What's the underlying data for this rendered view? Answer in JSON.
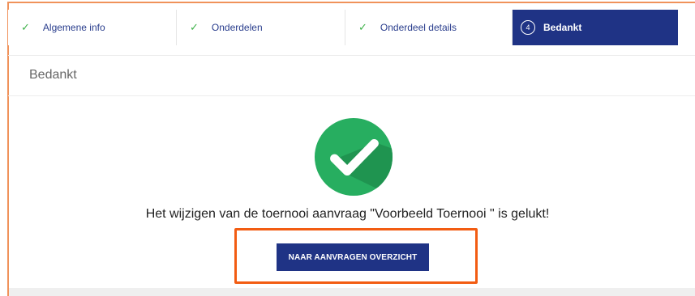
{
  "steps": [
    {
      "label": "Algemene info",
      "status": "done",
      "icon": "check-icon"
    },
    {
      "label": "Onderdelen",
      "status": "done",
      "icon": "check-icon"
    },
    {
      "label": "Onderdeel details",
      "status": "done",
      "icon": "check-icon"
    },
    {
      "number": "4",
      "label": "Bedankt",
      "status": "active"
    }
  ],
  "page": {
    "title": "Bedankt",
    "success_icon": "checkmark-circle-icon",
    "message": "Het wijzigen van de toernooi aanvraag \"Voorbeeld Toernooi \" is gelukt!",
    "button_label": "NAAR AANVRAGEN OVERZICHT"
  },
  "colors": {
    "primary": "#1f3385",
    "success": "#27ae60",
    "check": "#3fb24a",
    "highlight": "#f25c12"
  }
}
